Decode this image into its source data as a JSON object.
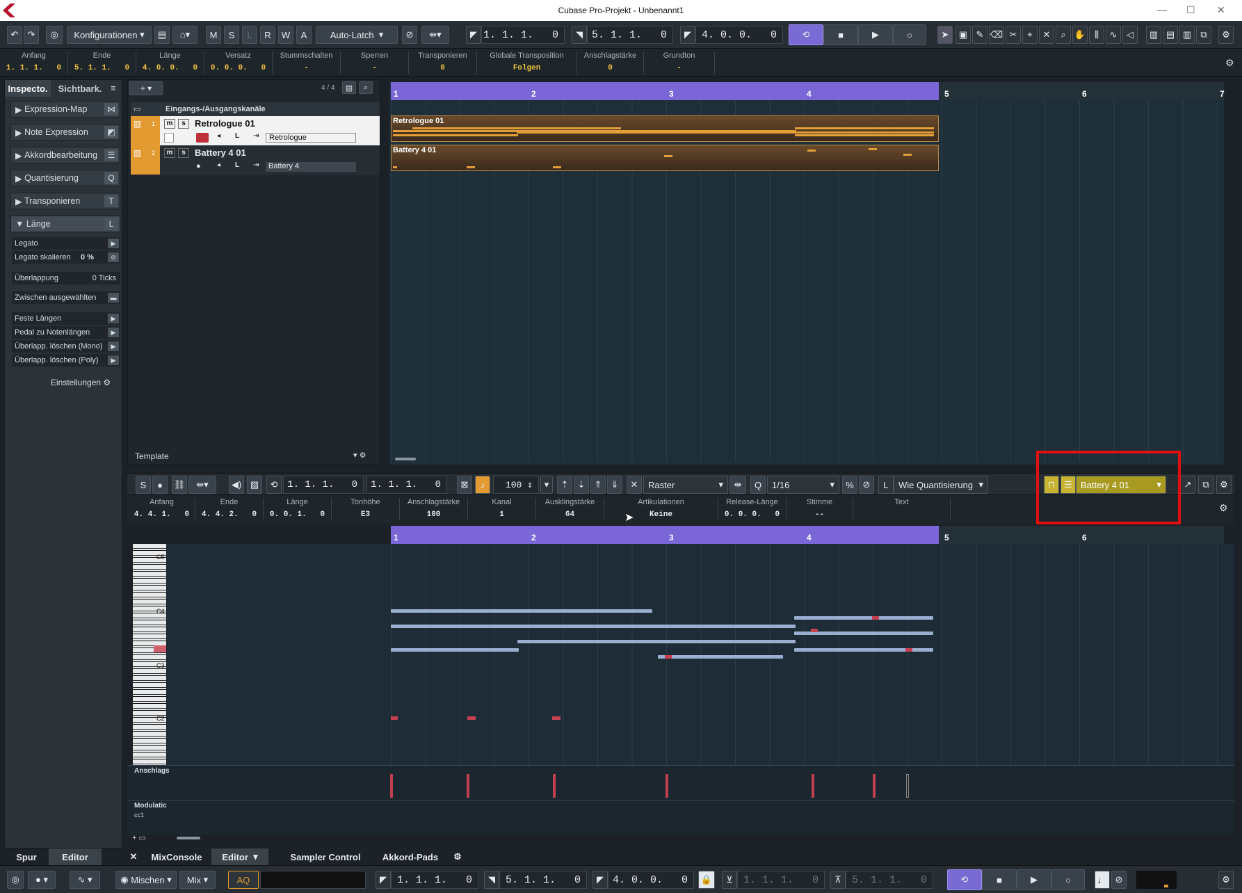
{
  "window": {
    "title": "Cubase Pro-Projekt - Unbenannt1"
  },
  "toolbar": {
    "config_label": "Konfigurationen",
    "mode_buttons": [
      "M",
      "S",
      "L",
      "R",
      "W",
      "A"
    ],
    "automation_mode": "Auto-Latch",
    "left_locator": "1. 1. 1.   0",
    "right_locator": "5. 1. 1.   0",
    "length_display": "4. 0. 0.   0"
  },
  "infoline": [
    {
      "label": "Anfang",
      "value": "1. 1. 1.   0"
    },
    {
      "label": "Ende",
      "value": "5. 1. 1.   0"
    },
    {
      "label": "Länge",
      "value": "4. 0. 0.   0"
    },
    {
      "label": "Versatz",
      "value": "0. 0. 0.   0"
    },
    {
      "label": "Stummschalten",
      "value": "-"
    },
    {
      "label": "Sperren",
      "value": "-"
    },
    {
      "label": "Transponieren",
      "value": "0"
    },
    {
      "label": "Globale Transposition",
      "value": "Folgen"
    },
    {
      "label": "Anschlagstärke",
      "value": "0"
    },
    {
      "label": "Grundton",
      "value": "-"
    }
  ],
  "inspector": {
    "tab_inspector": "Inspecto.",
    "tab_visibility": "Sichtbark.",
    "sections": [
      "Expression-Map",
      "Note Expression",
      "Akkordbearbeitung",
      "Quantisierung",
      "Transponieren",
      "Länge"
    ],
    "legato": "Legato",
    "legato_scale_label": "Legato skalieren",
    "legato_scale_value": "0 %",
    "overlap_label": "Überlappung",
    "overlap_value": "0 Ticks",
    "between_selected": "Zwischen ausgewählten",
    "functions": [
      "Feste Längen",
      "Pedal zu Notenlängen",
      "Überlapp. löschen (Mono)",
      "Überlapp. löschen (Poly)"
    ],
    "settings": "Einstellungen"
  },
  "tracklist": {
    "count": "4 / 4",
    "folder_label": "Eingangs-/Ausgangskanäle",
    "template_label": "Template",
    "tracks": [
      {
        "num": "1",
        "name": "Retrologue 01",
        "instrument": "Retrologue"
      },
      {
        "num": "2",
        "name": "Battery 4 01",
        "instrument": "Battery 4"
      }
    ]
  },
  "ruler_bars": [
    "1",
    "2",
    "3",
    "4",
    "5",
    "6",
    "7"
  ],
  "parts": [
    {
      "name": "Retrologue 01"
    },
    {
      "name": "Battery 4 01"
    }
  ],
  "editor": {
    "left": "1. 1. 1.   0",
    "right": "1. 1. 1.   0",
    "velocity": "100",
    "snap_label": "Raster",
    "quantize_value": "1/16",
    "length_quantize": "Wie Quantisierung",
    "edited_part": "Battery 4 01",
    "info": [
      {
        "label": "Anfang",
        "value": "4. 4. 1.   0"
      },
      {
        "label": "Ende",
        "value": "4. 4. 2.   0"
      },
      {
        "label": "Länge",
        "value": "0. 0. 1.   0"
      },
      {
        "label": "Tonhöhe",
        "value": "E3"
      },
      {
        "label": "Anschlagstärke",
        "value": "100"
      },
      {
        "label": "Kanal",
        "value": "1"
      },
      {
        "label": "Ausklingstärke",
        "value": "64"
      },
      {
        "label": "Artikulationen",
        "value": "Keine"
      },
      {
        "label": "Release-Länge",
        "value": "0. 0. 0.   0"
      },
      {
        "label": "Stimme",
        "value": "--"
      },
      {
        "label": "Text",
        "value": ""
      }
    ],
    "key_labels": [
      "C5",
      "C4",
      "C3",
      "C2"
    ],
    "lane_velocity": "Anschlags",
    "lane_mod": "Modulatic",
    "lane_mod_cc": "cc1"
  },
  "bottom_tabs": {
    "left": [
      "Spur",
      "Editor"
    ],
    "right": [
      "MixConsole",
      "Editor",
      "Sampler Control",
      "Akkord-Pads"
    ]
  },
  "statusbar": {
    "mix_label": "Mischen",
    "mix_mode": "Mix",
    "aq": "AQ",
    "left": "1. 1. 1.   0",
    "right": "5. 1. 1.   0",
    "length": "4. 0. 0.   0",
    "punch_in": "1. 1. 1.   0",
    "punch_out": "5. 1. 1.   0"
  }
}
